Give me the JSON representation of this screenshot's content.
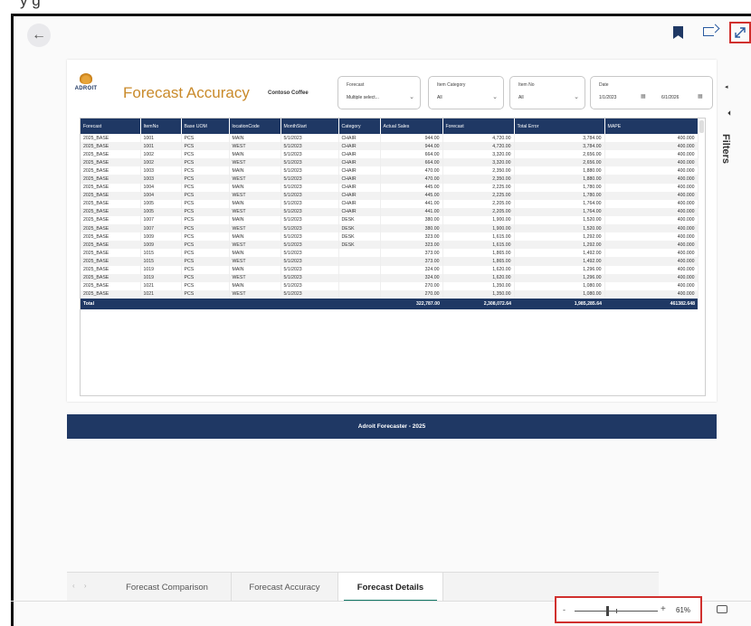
{
  "top_caption": "y                                         g",
  "report": {
    "brand": "ADROIT",
    "title": "Forecast Accuracy",
    "customer": "Contoso Coffee",
    "footer_text": "Adroit Forecaster - 2025"
  },
  "slicers": [
    {
      "label": "Forecast",
      "value": "Multiple select..."
    },
    {
      "label": "Item Category",
      "value": "All"
    },
    {
      "label": "Item No",
      "value": "All"
    }
  ],
  "date_slicer": {
    "label": "Date",
    "from": "1/1/2023",
    "to": "6/1/2026"
  },
  "table": {
    "columns": [
      "Forecast",
      "ItemNo",
      "Base UOM",
      "locationCode",
      "MonthStart",
      "Category",
      "Actual Sales",
      "Forecast",
      "Total Error",
      "MAPE"
    ],
    "rows": [
      [
        "2025_BASE",
        "1001",
        "PCS",
        "MAIN",
        "5/1/2023",
        "CHAIR",
        "944.00",
        "4,720.00",
        "3,784.00",
        "400.000"
      ],
      [
        "2025_BASE",
        "1001",
        "PCS",
        "WEST",
        "5/1/2023",
        "CHAIR",
        "944.00",
        "4,720.00",
        "3,784.00",
        "400.000"
      ],
      [
        "2025_BASE",
        "1002",
        "PCS",
        "MAIN",
        "5/1/2023",
        "CHAIR",
        "664.00",
        "3,320.00",
        "2,656.00",
        "400.000"
      ],
      [
        "2025_BASE",
        "1002",
        "PCS",
        "WEST",
        "5/1/2023",
        "CHAIR",
        "664.00",
        "3,320.00",
        "2,656.00",
        "400.000"
      ],
      [
        "2025_BASE",
        "1003",
        "PCS",
        "MAIN",
        "5/1/2023",
        "CHAIR",
        "470.00",
        "2,350.00",
        "1,880.00",
        "400.000"
      ],
      [
        "2025_BASE",
        "1003",
        "PCS",
        "WEST",
        "5/1/2023",
        "CHAIR",
        "470.00",
        "2,350.00",
        "1,880.00",
        "400.000"
      ],
      [
        "2025_BASE",
        "1004",
        "PCS",
        "MAIN",
        "5/1/2023",
        "CHAIR",
        "445.00",
        "2,225.00",
        "1,780.00",
        "400.000"
      ],
      [
        "2025_BASE",
        "1004",
        "PCS",
        "WEST",
        "5/1/2023",
        "CHAIR",
        "445.00",
        "2,225.00",
        "1,780.00",
        "400.000"
      ],
      [
        "2025_BASE",
        "1005",
        "PCS",
        "MAIN",
        "5/1/2023",
        "CHAIR",
        "441.00",
        "2,205.00",
        "1,764.00",
        "400.000"
      ],
      [
        "2025_BASE",
        "1005",
        "PCS",
        "WEST",
        "5/1/2023",
        "CHAIR",
        "441.00",
        "2,205.00",
        "1,764.00",
        "400.000"
      ],
      [
        "2025_BASE",
        "1007",
        "PCS",
        "MAIN",
        "5/1/2023",
        "DESK",
        "380.00",
        "1,900.00",
        "1,520.00",
        "400.000"
      ],
      [
        "2025_BASE",
        "1007",
        "PCS",
        "WEST",
        "5/1/2023",
        "DESK",
        "380.00",
        "1,900.00",
        "1,520.00",
        "400.000"
      ],
      [
        "2025_BASE",
        "1009",
        "PCS",
        "MAIN",
        "5/1/2023",
        "DESK",
        "323.00",
        "1,615.00",
        "1,292.00",
        "400.000"
      ],
      [
        "2025_BASE",
        "1009",
        "PCS",
        "WEST",
        "5/1/2023",
        "DESK",
        "323.00",
        "1,615.00",
        "1,292.00",
        "400.000"
      ],
      [
        "2025_BASE",
        "1015",
        "PCS",
        "MAIN",
        "5/1/2023",
        "",
        "373.00",
        "1,865.00",
        "1,492.00",
        "400.000"
      ],
      [
        "2025_BASE",
        "1015",
        "PCS",
        "WEST",
        "5/1/2023",
        "",
        "373.00",
        "1,865.00",
        "1,492.00",
        "400.000"
      ],
      [
        "2025_BASE",
        "1019",
        "PCS",
        "MAIN",
        "5/1/2023",
        "",
        "324.00",
        "1,620.00",
        "1,296.00",
        "400.000"
      ],
      [
        "2025_BASE",
        "1019",
        "PCS",
        "WEST",
        "5/1/2023",
        "",
        "324.00",
        "1,620.00",
        "1,296.00",
        "400.000"
      ],
      [
        "2025_BASE",
        "1021",
        "PCS",
        "MAIN",
        "5/1/2023",
        "",
        "270.00",
        "1,350.00",
        "1,080.00",
        "400.000"
      ],
      [
        "2025_BASE",
        "1021",
        "PCS",
        "WEST",
        "5/1/2023",
        "",
        "270.00",
        "1,350.00",
        "1,080.00",
        "400.000"
      ]
    ],
    "total": {
      "label": "Total",
      "actual_sales": "322,787.00",
      "forecast": "2,308,072.64",
      "total_error": "1,985,285.64",
      "mape": "461382.648"
    }
  },
  "filters_pane": {
    "label": "Filters"
  },
  "tabs": [
    {
      "label": "Forecast Comparison"
    },
    {
      "label": "Forecast Accuracy"
    },
    {
      "label": "Forecast Details"
    }
  ],
  "zoom": {
    "percent_label": "61%",
    "level": 0.61
  },
  "icons": {
    "back": "back-arrow-icon",
    "bookmark": "bookmark-icon",
    "share": "share-icon",
    "expand": "expand-icon",
    "filter": "filter-icon",
    "fit": "fit-to-page-icon"
  },
  "colors": {
    "header_navy": "#1f3864",
    "title_gold": "#c98a2a",
    "highlight_red": "#d0302e",
    "active_tab": "#117865"
  }
}
